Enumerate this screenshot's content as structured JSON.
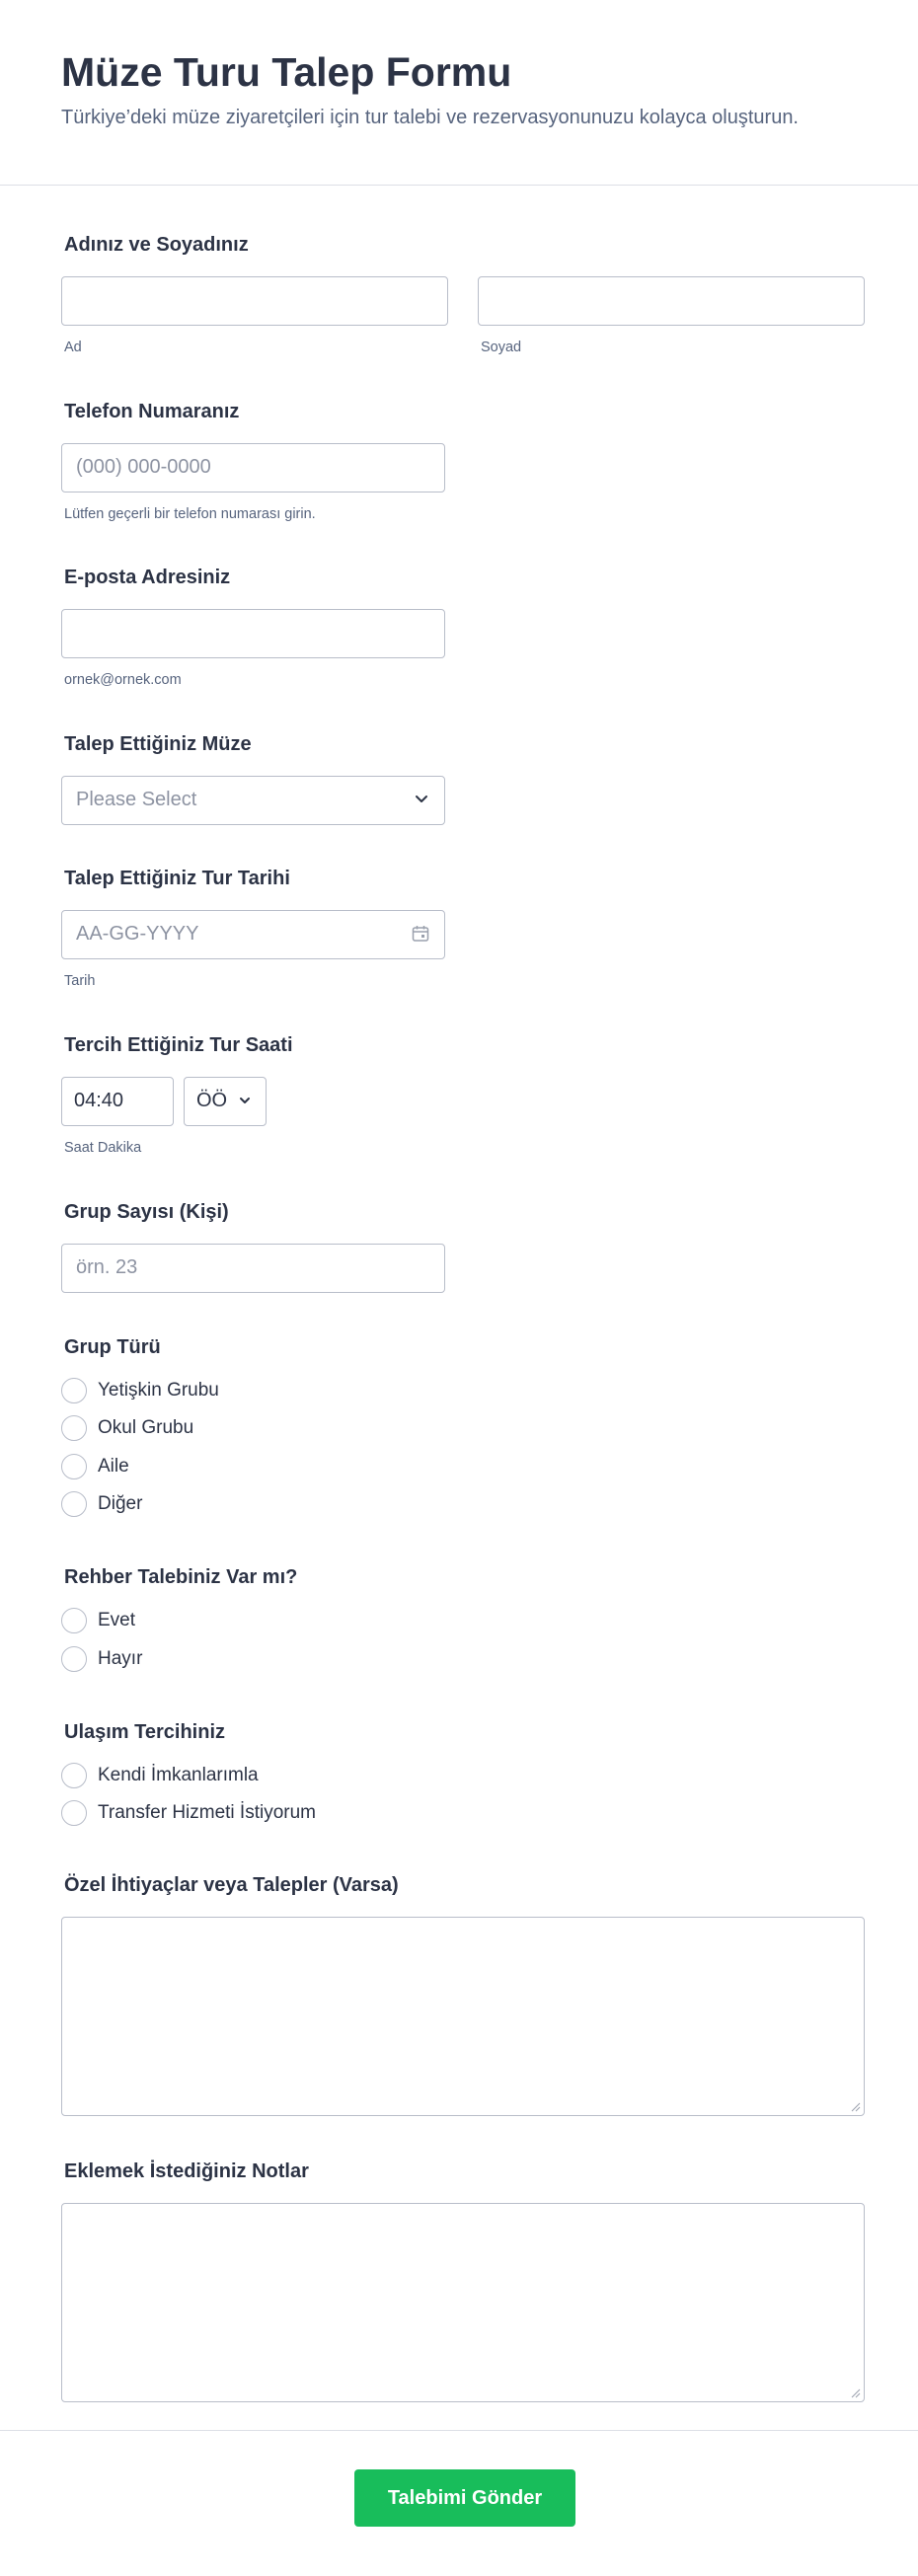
{
  "header": {
    "title": "Müze Turu Talep Formu",
    "subtitle": "Türkiye’deki müze ziyaretçileri için tur talebi ve rezervasyonunuzu kolayca oluşturun."
  },
  "fields": {
    "name": {
      "label": "Adınız ve Soyadınız",
      "first_sub": "Ad",
      "last_sub": "Soyad",
      "first_value": "",
      "last_value": ""
    },
    "phone": {
      "label": "Telefon Numaranız",
      "placeholder": "(000) 000-0000",
      "sub": "Lütfen geçerli bir telefon numarası girin."
    },
    "email": {
      "label": "E-posta Adresiniz",
      "value": "",
      "sub": "ornek@ornek.com"
    },
    "museum": {
      "label": "Talep Ettiğiniz Müze",
      "placeholder": "Please Select",
      "icon": "chevron-down-icon"
    },
    "date": {
      "label": "Talep Ettiğiniz Tur Tarihi",
      "placeholder": "AA-GG-YYYY",
      "sub": "Tarih",
      "icon": "calendar-icon"
    },
    "time": {
      "label": "Tercih Ettiğiniz Tur Saati",
      "value": "04:40",
      "ampm": "ÖÖ",
      "sub": "Saat Dakika"
    },
    "group_size": {
      "label": "Grup Sayısı (Kişi)",
      "placeholder": "örn. 23"
    },
    "group_type": {
      "label": "Grup Türü",
      "options": [
        "Yetişkin Grubu",
        "Okul Grubu",
        "Aile",
        "Diğer"
      ]
    },
    "guide": {
      "label": "Rehber Talebiniz Var mı?",
      "options": [
        "Evet",
        "Hayır"
      ]
    },
    "transport": {
      "label": "Ulaşım Tercihiniz",
      "options": [
        "Kendi İmkanlarımla",
        "Transfer Hizmeti İstiyorum"
      ]
    },
    "special_needs": {
      "label": "Özel İhtiyaçlar veya Talepler (Varsa)",
      "value": ""
    },
    "notes": {
      "label": "Eklemek İstediğiniz Notlar",
      "value": ""
    }
  },
  "submit": {
    "label": "Talebimi Gönder"
  },
  "colors": {
    "accent": "#18bd5b",
    "text": "#2c3345",
    "muted": "#57647e",
    "border": "#b8bdc9"
  }
}
